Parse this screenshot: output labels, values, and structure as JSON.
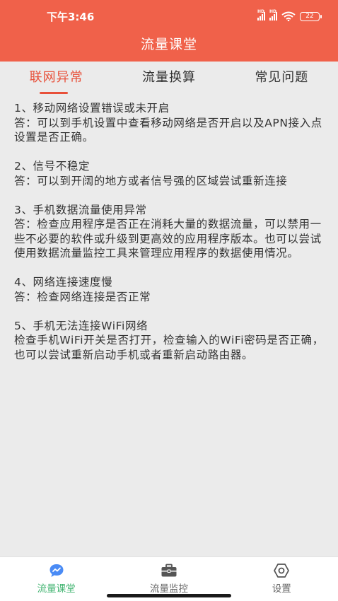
{
  "status_bar": {
    "time": "下午3:46",
    "battery": "22",
    "hd1": "HD",
    "hd2": "HD"
  },
  "header": {
    "title": "流量课堂"
  },
  "tabs": [
    {
      "label": "联网异常"
    },
    {
      "label": "流量换算"
    },
    {
      "label": "常见问题"
    }
  ],
  "faqs": [
    {
      "q": "1、移动网络设置错误或未开启",
      "a": "答：可以到手机设置中查看移动网络是否开启以及APN接入点设置是否正确。"
    },
    {
      "q": "2、信号不稳定",
      "a": "答：可以到开阔的地方或者信号强的区域尝试重新连接"
    },
    {
      "q": "3、手机数据流量使用异常",
      "a": "答：检查应用程序是否正在消耗大量的数据流量，可以禁用一些不必要的软件或升级到更高效的应用程序版本。也可以尝试使用数据流量监控工具来管理应用程序的数据使用情况。"
    },
    {
      "q": "4、网络连接速度慢",
      "a": "答：检查网络连接是否正常"
    },
    {
      "q": "5、手机无法连接WiFi网络",
      "a": "检查手机WiFi开关是否打开，检查输入的WiFi密码是否正确，也可以尝试重新启动手机或者重新启动路由器。"
    }
  ],
  "bottom_nav": [
    {
      "label": "流量课堂",
      "icon": "chart-bubble-icon"
    },
    {
      "label": "流量监控",
      "icon": "briefcase-icon"
    },
    {
      "label": "设置",
      "icon": "gear-icon"
    }
  ],
  "colors": {
    "accent": "#f0614a",
    "tab_active": "#e8503a",
    "nav_active": "#3fb36f",
    "background": "#ebebeb"
  }
}
